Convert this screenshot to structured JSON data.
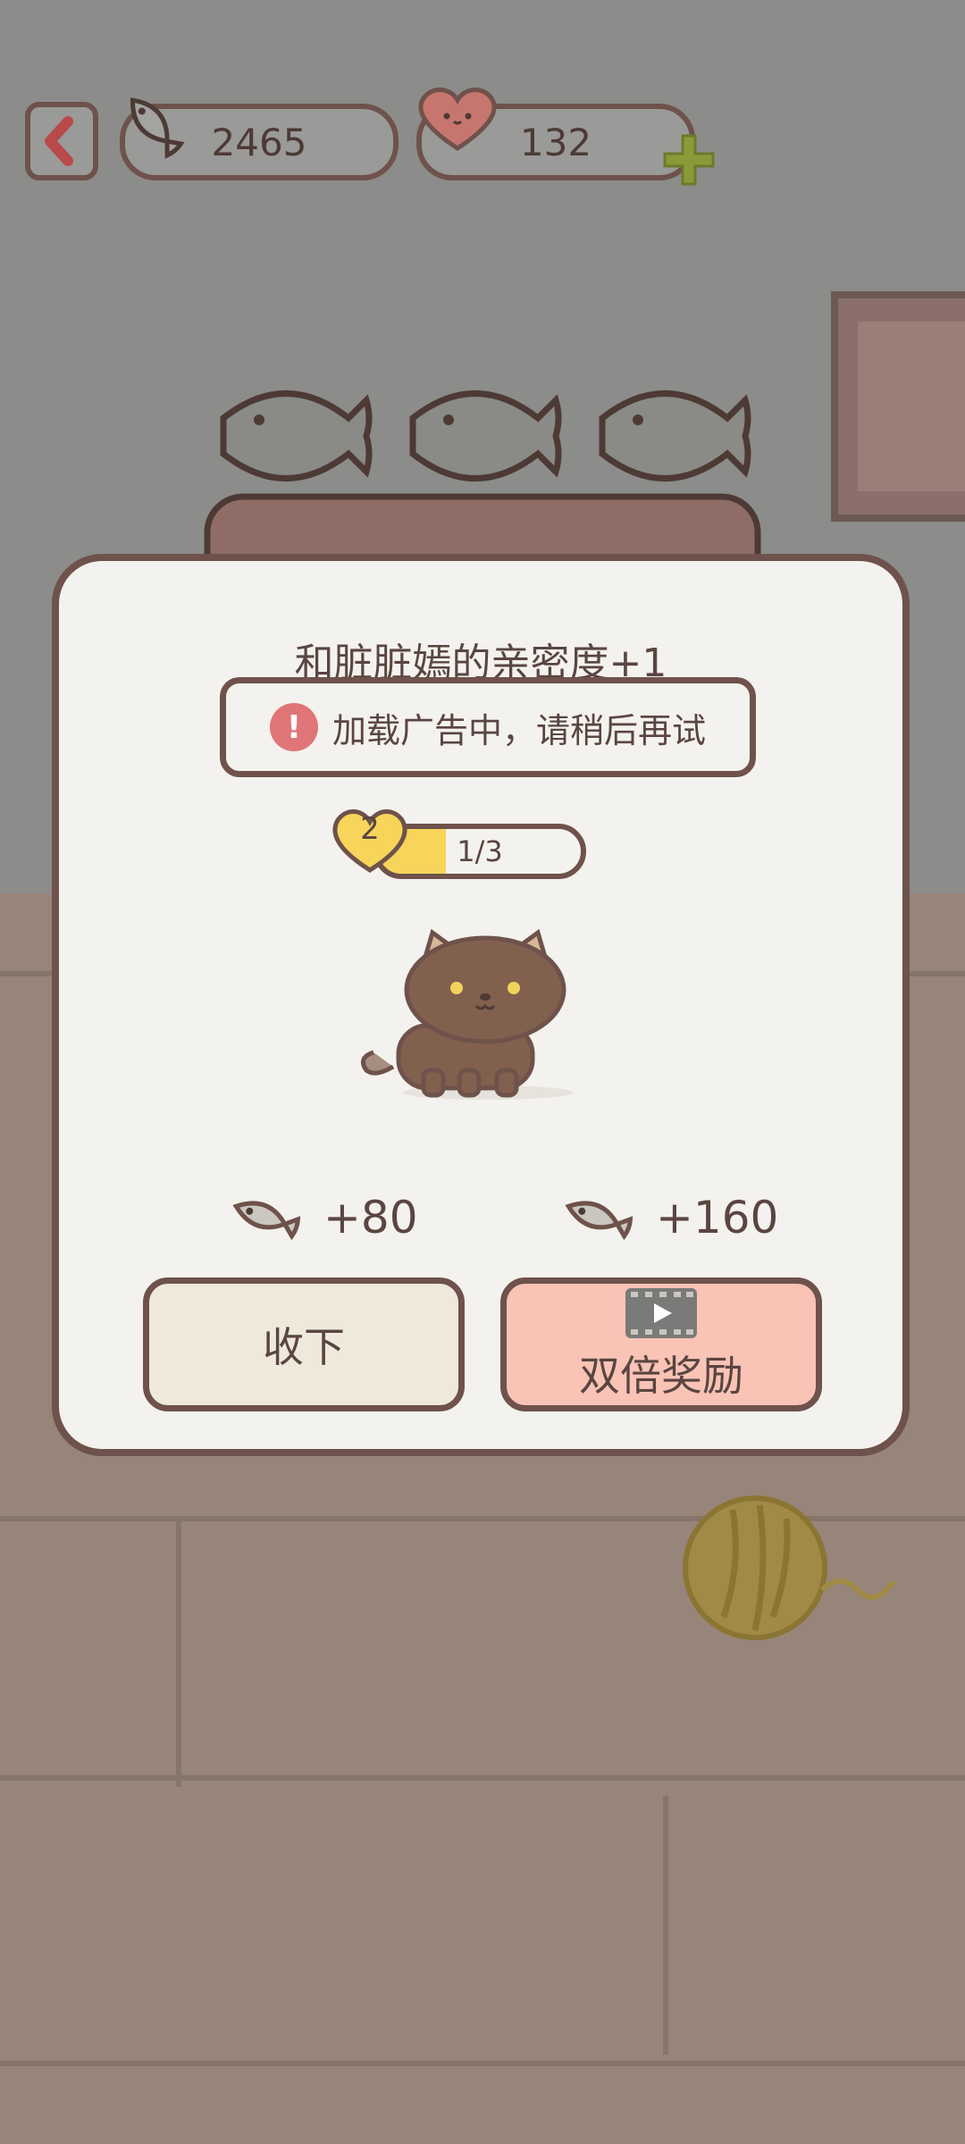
{
  "topbar": {
    "fish_count": "2465",
    "heart_count": "132"
  },
  "modal": {
    "title": "和脏脏嫣的亲密度+1",
    "notice": "加载广告中，请稍后再试",
    "notice_icon": "!",
    "level": "2",
    "progress_text": "1/3",
    "progress_fraction": 0.333,
    "reward_normal": "+80",
    "reward_double": "+160",
    "collect_label": "收下",
    "double_label": "双倍奖励"
  },
  "colors": {
    "border": "#6e524b",
    "modal_bg": "#f4f2ee",
    "progress_fill": "#f7d55a",
    "double_button": "#f9c3b6",
    "collect_button": "#efe9dc",
    "alert": "#e07578"
  }
}
